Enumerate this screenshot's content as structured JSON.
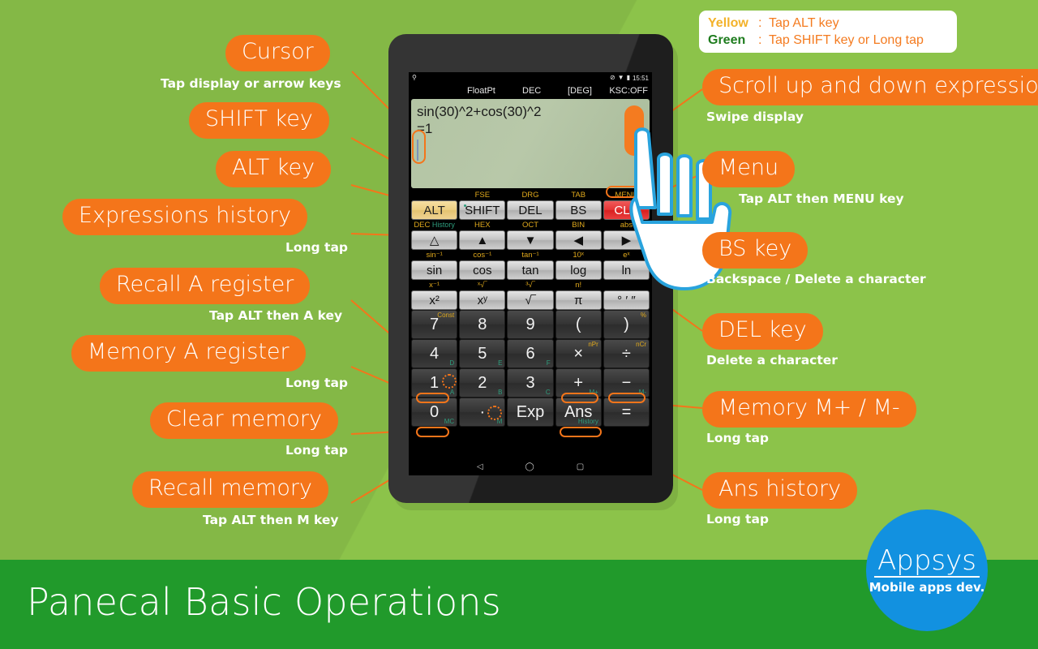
{
  "page": {
    "title": "Panecal Basic Operations",
    "background_color": "#8cc34a",
    "band_color": "#219a2b",
    "accent_color": "#f4751a"
  },
  "legend": {
    "rows": [
      {
        "key": "Yellow",
        "sep": ":",
        "value": "Tap ALT key",
        "key_color": "#f3b22a"
      },
      {
        "key": "Green",
        "sep": ":",
        "value": "Tap SHIFT key or Long tap",
        "key_color": "#1e7c1e"
      }
    ]
  },
  "device": {
    "status_bar": {
      "left_icons": [
        "pin-icon"
      ],
      "right_icons": [
        "mute-icon",
        "wifi-icon",
        "battery-icon"
      ],
      "clock": "15:51"
    },
    "mode_bar": {
      "float": "FloatPt",
      "base": "DEC",
      "angle": "[DEG]",
      "ksc": "KSC:OFF"
    },
    "display": {
      "expression": "sin(30)^2+cos(30)^2",
      "result": "=1"
    },
    "nav_bar": {
      "back": "◁",
      "home": "◯",
      "recents": "▢"
    },
    "keypad": {
      "rows": [
        {
          "alt_labels": [
            "",
            "FSE",
            "DRG",
            "TAB",
            "MENU"
          ],
          "keys": [
            {
              "label": "ALT",
              "style": "amber"
            },
            {
              "label": "SHIFT",
              "style": "light",
              "dot": true
            },
            {
              "label": "DEL",
              "style": "light"
            },
            {
              "label": "BS",
              "style": "light"
            },
            {
              "label": "CLR",
              "style": "red"
            }
          ]
        },
        {
          "alt_labels": [
            "DEC",
            "HEX",
            "OCT",
            "BIN",
            "abs"
          ],
          "alt_extra": [
            "History",
            "",
            "",
            "",
            ""
          ],
          "keys": [
            {
              "label": "△",
              "style": "light"
            },
            {
              "label": "▲",
              "style": "light"
            },
            {
              "label": "▼",
              "style": "light"
            },
            {
              "label": "◀",
              "style": "light"
            },
            {
              "label": "▶",
              "style": "light"
            }
          ]
        },
        {
          "alt_labels": [
            "sin⁻¹",
            "cos⁻¹",
            "tan⁻¹",
            "10ˣ",
            "eˣ"
          ],
          "keys": [
            {
              "label": "sin",
              "style": "light"
            },
            {
              "label": "cos",
              "style": "light"
            },
            {
              "label": "tan",
              "style": "light"
            },
            {
              "label": "log",
              "style": "light"
            },
            {
              "label": "ln",
              "style": "light"
            }
          ]
        },
        {
          "alt_labels": [
            "x⁻¹",
            "ˣ√‾",
            "³√‾",
            "n!",
            ""
          ],
          "keys": [
            {
              "label": "x²",
              "style": "light"
            },
            {
              "label": "xʸ",
              "style": "light"
            },
            {
              "label": "√‾",
              "style": "light"
            },
            {
              "label": "π",
              "style": "light"
            },
            {
              "label": "° ′ ″",
              "style": "light"
            }
          ]
        },
        {
          "keys": [
            {
              "label": "7",
              "style": "dark",
              "sup": "Const"
            },
            {
              "label": "8",
              "style": "dark"
            },
            {
              "label": "9",
              "style": "dark"
            },
            {
              "label": "(",
              "style": "dark"
            },
            {
              "label": ")",
              "style": "dark",
              "sup": "%"
            }
          ]
        },
        {
          "keys": [
            {
              "label": "4",
              "style": "dark",
              "subgreen": "D"
            },
            {
              "label": "5",
              "style": "dark",
              "subgreen": "E"
            },
            {
              "label": "6",
              "style": "dark",
              "subgreen": "F"
            },
            {
              "label": "×",
              "style": "dark",
              "sup": "nPr"
            },
            {
              "label": "÷",
              "style": "dark",
              "sup": "nCr"
            }
          ]
        },
        {
          "keys": [
            {
              "label": "1",
              "style": "dark",
              "subgreen": "A"
            },
            {
              "label": "2",
              "style": "dark",
              "subgreen": "B"
            },
            {
              "label": "3",
              "style": "dark",
              "subgreen": "C"
            },
            {
              "label": "+",
              "style": "dark",
              "subgreen": "M+"
            },
            {
              "label": "−",
              "style": "dark",
              "subgreen": "M-"
            }
          ]
        },
        {
          "keys": [
            {
              "label": "0",
              "style": "dark",
              "subgreen": "MC"
            },
            {
              "label": "·",
              "style": "dark",
              "subgreen": "M"
            },
            {
              "label": "Exp",
              "style": "dark"
            },
            {
              "label": "Ans",
              "style": "dark",
              "subgreen": "History"
            },
            {
              "label": "=",
              "style": "dark"
            }
          ]
        }
      ]
    }
  },
  "callouts": [
    {
      "id": "cursor",
      "title": "Cursor",
      "sub": "Tap display or arrow keys"
    },
    {
      "id": "shift-key",
      "title": "SHIFT key",
      "sub": ""
    },
    {
      "id": "alt-key",
      "title": "ALT key",
      "sub": ""
    },
    {
      "id": "expressions-history",
      "title": "Expressions history",
      "sub": "Long tap"
    },
    {
      "id": "recall-a-register",
      "title": "Recall A register",
      "sub": "Tap ALT then A key"
    },
    {
      "id": "memory-a-register",
      "title": "Memory A register",
      "sub": "Long tap"
    },
    {
      "id": "clear-memory",
      "title": "Clear memory",
      "sub": "Long tap"
    },
    {
      "id": "recall-memory",
      "title": "Recall memory",
      "sub": "Tap ALT then M key"
    },
    {
      "id": "scroll-expressions",
      "title": "Scroll up and down expressions",
      "sub": "Swipe display"
    },
    {
      "id": "menu",
      "title": "Menu",
      "sub": "Tap ALT then MENU key"
    },
    {
      "id": "bs-key",
      "title": "BS key",
      "sub": "Backspace / Delete a character"
    },
    {
      "id": "del-key",
      "title": "DEL key",
      "sub": "Delete a character"
    },
    {
      "id": "memory-m-plus-minus",
      "title": "Memory M+ / M-",
      "sub": "Long tap"
    },
    {
      "id": "ans-history",
      "title": "Ans history",
      "sub": "Long tap"
    }
  ],
  "badge": {
    "name": "Appsys",
    "tagline": "Mobile apps dev."
  }
}
